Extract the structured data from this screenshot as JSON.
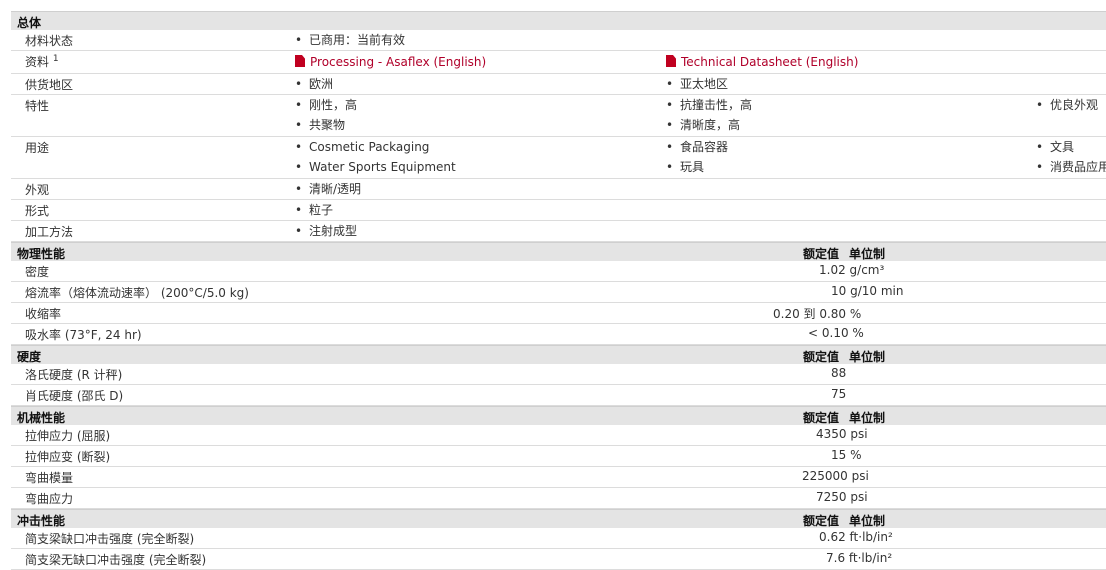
{
  "general": {
    "title": "总体",
    "material_status_label": "材料状态",
    "material_status_value": "已商用：当前有效",
    "docs_label": "资料",
    "docs_sup": "1",
    "doc1": "Processing - Asaflex (English)",
    "doc2": "Technical Datasheet (English)",
    "region_label": "供货地区",
    "region1": "欧洲",
    "region2": "亚太地区",
    "features_label": "特性",
    "features": [
      "刚性，高",
      "共聚物",
      "抗撞击性，高",
      "清晰度，高",
      "优良外观"
    ],
    "uses_label": "用途",
    "uses": [
      "Cosmetic Packaging",
      "Water Sports Equipment",
      "食品容器",
      "玩具",
      "文具",
      "消费品应用"
    ],
    "appearance_label": "外观",
    "appearance_value": "清晰/透明",
    "form_label": "形式",
    "form_value": "粒子",
    "processing_label": "加工方法",
    "processing_value": "注射成型"
  },
  "physical": {
    "title": "物理性能",
    "col_a": "额定值",
    "col_b": "单位制",
    "rows": [
      {
        "label": "密度",
        "value": "1.02 g/cm³"
      },
      {
        "label": "熔流率（熔体流动速率） (200°C/5.0 kg)",
        "value": "10 g/10 min"
      },
      {
        "label": "收缩率",
        "value": "0.20 到 0.80 %"
      },
      {
        "label": "吸水率 (73°F, 24 hr)",
        "value": "< 0.10 %"
      }
    ]
  },
  "hardness": {
    "title": "硬度",
    "col_a": "额定值",
    "col_b": "单位制",
    "rows": [
      {
        "label": "洛氏硬度 (R 计秤)",
        "value": "88"
      },
      {
        "label": "肖氏硬度 (邵氏 D)",
        "value": "75"
      }
    ]
  },
  "mechanical": {
    "title": "机械性能",
    "col_a": "额定值",
    "col_b": "单位制",
    "rows": [
      {
        "label": "拉伸应力 (屈服)",
        "value": "4350 psi"
      },
      {
        "label": "拉伸应变 (断裂)",
        "value": "15 %"
      },
      {
        "label": "弯曲模量",
        "value": "225000 psi"
      },
      {
        "label": "弯曲应力",
        "value": "7250 psi"
      }
    ]
  },
  "impact": {
    "title": "冲击性能",
    "col_a": "额定值",
    "col_b": "单位制",
    "rows": [
      {
        "label": "简支梁缺口冲击强度 (完全断裂)",
        "value": "0.62 ft·lb/in²"
      },
      {
        "label": "简支梁无缺口冲击强度 (完全断裂)",
        "value": "7.6 ft·lb/in²"
      }
    ]
  }
}
